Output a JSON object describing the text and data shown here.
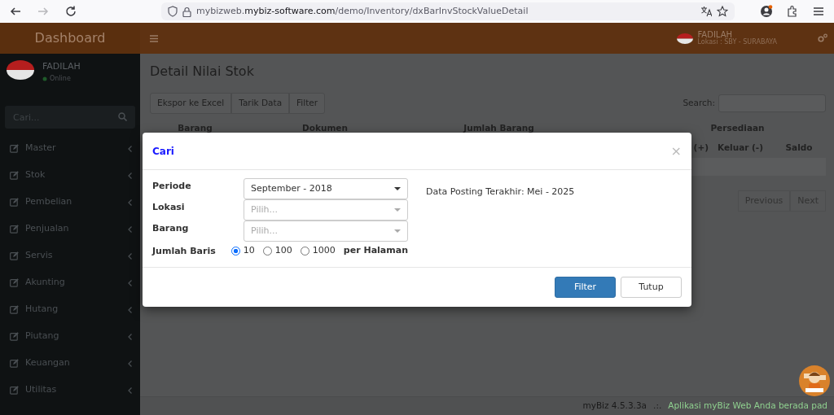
{
  "browser": {
    "nav_buttons": [
      {
        "kind": "back",
        "disabled": false
      },
      {
        "kind": "forward",
        "disabled": true
      },
      {
        "kind": "reload",
        "disabled": false
      }
    ],
    "url": "mybizweb.**mybiz-software.com**/demo/Inventory/dxBarInvStockValueDetail"
  },
  "header": {
    "logo": "Dashboard",
    "user_name": "FADILAH",
    "location": "Lokasi : SBY - SURABAYA"
  },
  "sidebar": {
    "user": {
      "name": "FADILAH",
      "status": "Online"
    },
    "search": {
      "placeholder": "Cari..."
    },
    "items": [
      {
        "label": "Master"
      },
      {
        "label": "Stok"
      },
      {
        "label": "Pembelian"
      },
      {
        "label": "Penjualan"
      },
      {
        "label": "Servis"
      },
      {
        "label": "Akunting"
      },
      {
        "label": "Hutang"
      },
      {
        "label": "Piutang"
      },
      {
        "label": "Keuangan"
      },
      {
        "label": "Utilitas"
      }
    ]
  },
  "page": {
    "title": "Detail Nilai Stok",
    "toolbar": [
      "Ekspor ke Excel",
      "Tarik Data",
      "Filter"
    ],
    "search_label": "Search:",
    "table": {
      "header_row_1": [
        "Barang",
        "Dokumen",
        "Jumlah Barang",
        "Persediaan"
      ],
      "header_row_2": [
        "(+)",
        "Keluar (-)",
        "Saldo"
      ]
    },
    "pagination": [
      "Previous",
      "Next"
    ]
  },
  "modal": {
    "title": "Cari",
    "close": "×",
    "fields": [
      {
        "label": "Periode",
        "kind": "select",
        "value": "September - 2018"
      },
      {
        "label": "Lokasi",
        "kind": "select",
        "placeholder": "Pilih..."
      },
      {
        "label": "Barang",
        "kind": "select",
        "placeholder": "Pilih..."
      },
      {
        "label": "Jumlah Baris",
        "kind": "radio",
        "options": [
          {
            "label": "10",
            "selected": true
          },
          {
            "label": "100",
            "selected": false
          },
          {
            "label": "1000",
            "selected": false
          }
        ],
        "suffix": "per Halaman"
      }
    ],
    "note": "Data Posting Terakhir: Mei - 2025",
    "buttons": [
      {
        "label": "Filter",
        "kind": "primary"
      },
      {
        "label": "Tutup",
        "kind": "secondary"
      }
    ]
  },
  "footer": {
    "version": "myBiz 4.5.3.3a",
    "separator": ".:.",
    "message": "Aplikasi myBiz Web Anda berada pad"
  }
}
